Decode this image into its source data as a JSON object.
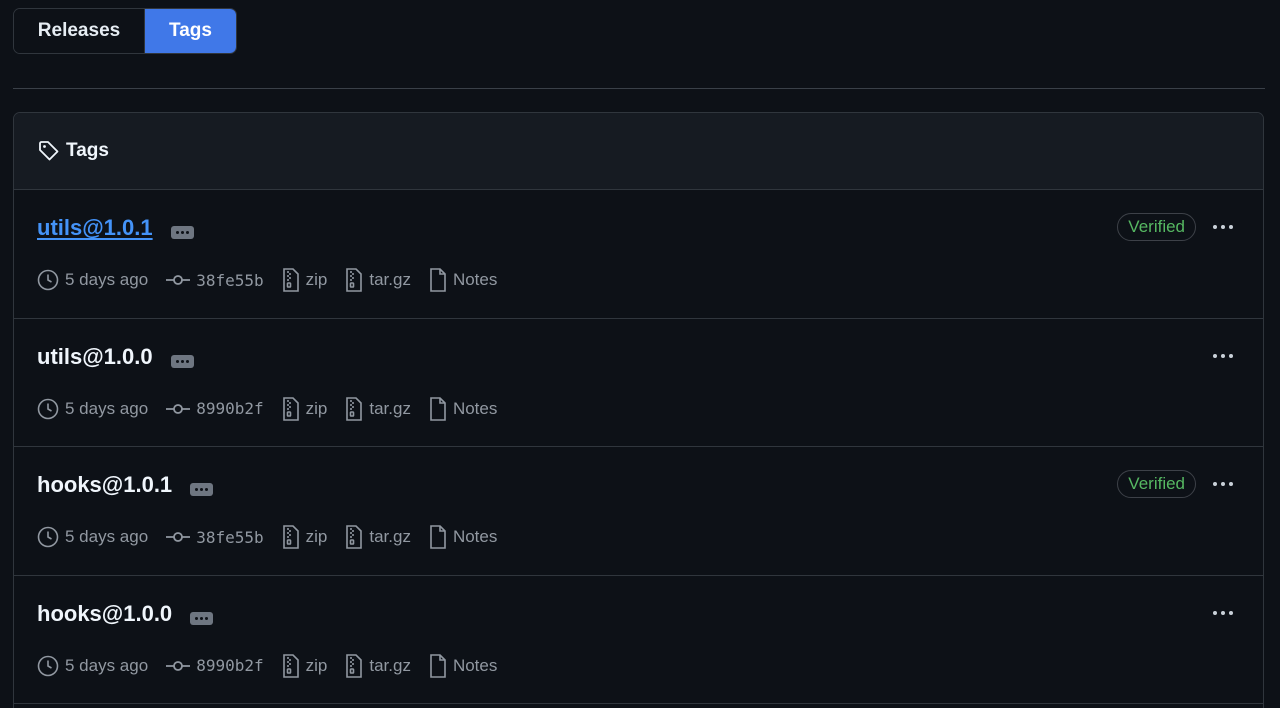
{
  "tabs": {
    "releases": "Releases",
    "tags": "Tags"
  },
  "header": {
    "title": "Tags",
    "icon": "tag-icon"
  },
  "rows": [
    {
      "name": "utils@1.0.1",
      "link": true,
      "verified": "Verified",
      "date": "5 days ago",
      "commit": "38fe55b",
      "zip": "zip",
      "targz": "tar.gz",
      "notes": "Notes"
    },
    {
      "name": "utils@1.0.0",
      "link": false,
      "verified": "",
      "date": "5 days ago",
      "commit": "8990b2f",
      "zip": "zip",
      "targz": "tar.gz",
      "notes": "Notes"
    },
    {
      "name": "hooks@1.0.1",
      "link": false,
      "verified": "Verified",
      "date": "5 days ago",
      "commit": "38fe55b",
      "zip": "zip",
      "targz": "tar.gz",
      "notes": "Notes"
    },
    {
      "name": "hooks@1.0.0",
      "link": false,
      "verified": "",
      "date": "5 days ago",
      "commit": "8990b2f",
      "zip": "zip",
      "targz": "tar.gz",
      "notes": "Notes"
    }
  ],
  "colors": {
    "accent": "#4078e8",
    "link": "#4493f8",
    "verified": "#56b862",
    "background": "#0d1117"
  }
}
